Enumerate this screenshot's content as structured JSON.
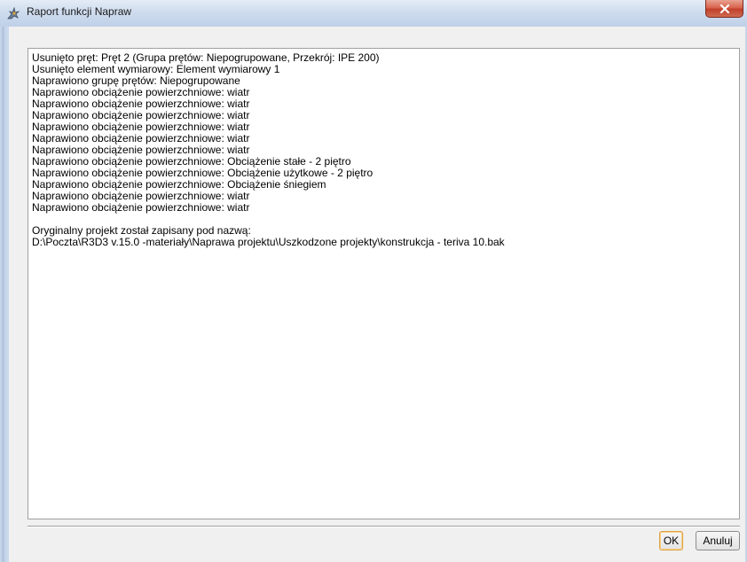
{
  "window": {
    "title": "Raport funkcji Napraw",
    "icons": {
      "app": "robot-app-icon",
      "close": "close-icon"
    }
  },
  "report": {
    "lines": [
      "Usunięto pręt: Pręt 2 (Grupa prętów: Niepogrupowane, Przekrój: IPE 200)",
      "Usunięto element wymiarowy: Element wymiarowy 1",
      "Naprawiono grupę prętów: Niepogrupowane",
      "Naprawiono obciążenie powierzchniowe: wiatr",
      "Naprawiono obciążenie powierzchniowe: wiatr",
      "Naprawiono obciążenie powierzchniowe: wiatr",
      "Naprawiono obciążenie powierzchniowe: wiatr",
      "Naprawiono obciążenie powierzchniowe: wiatr",
      "Naprawiono obciążenie powierzchniowe: wiatr",
      "Naprawiono obciążenie powierzchniowe: Obciążenie stałe - 2 piętro",
      "Naprawiono obciążenie powierzchniowe: Obciążenie użytkowe - 2 piętro",
      "Naprawiono obciążenie powierzchniowe: Obciążenie śniegiem",
      "Naprawiono obciążenie powierzchniowe: wiatr",
      "Naprawiono obciążenie powierzchniowe: wiatr",
      "",
      "Oryginalny projekt został zapisany pod nazwą:",
      "D:\\Poczta\\R3D3 v.15.0 -materiały\\Naprawa projektu\\Uszkodzone projekty\\konstrukcja - teriva 10.bak"
    ]
  },
  "buttons": {
    "ok_label": "OK",
    "cancel_label": "Anuluj"
  }
}
